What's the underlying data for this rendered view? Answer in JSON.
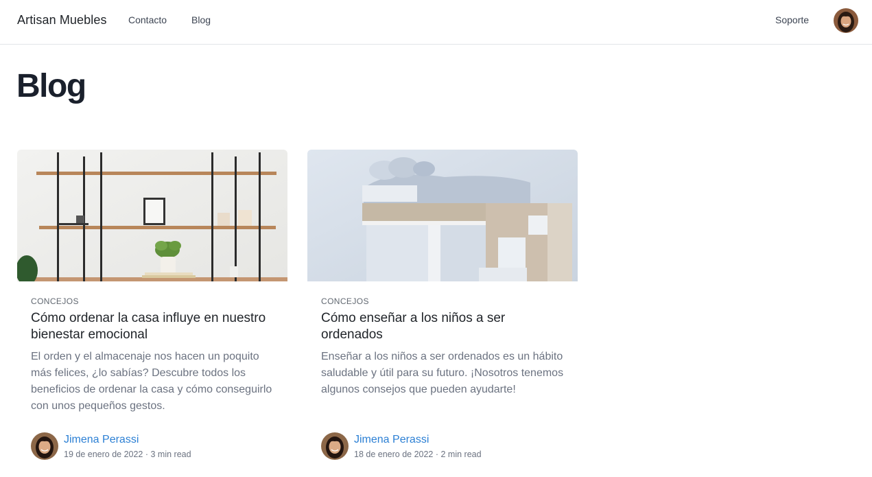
{
  "header": {
    "brand": "Artisan Muebles",
    "nav": [
      {
        "label": "Contacto"
      },
      {
        "label": "Blog"
      }
    ],
    "support_label": "Soporte"
  },
  "page": {
    "title": "Blog"
  },
  "posts": [
    {
      "category": "CONCEJOS",
      "title": "Cómo ordenar la casa influye en nuestro bienestar emocional",
      "excerpt": "El orden y el almacenaje nos hacen un poquito más felices, ¿lo sabías? Descubre todos los beneficios de ordenar la casa y cómo conseguirlo con unos pequeños gestos.",
      "author": "Jimena Perassi",
      "meta": "19 de enero de 2022 · 3 min read"
    },
    {
      "category": "CONCEJOS",
      "title": "Cómo enseñar a los niños a ser ordenados",
      "excerpt": "Enseñar a los niños a ser ordenados es un hábito saludable y útil para su futuro. ¡Nosotros tenemos algunos consejos que pueden ayudarte!",
      "author": "Jimena Perassi",
      "meta": "18 de enero de 2022 · 2 min read"
    }
  ],
  "colors": {
    "link": "#2b7fd4",
    "heading": "#1a202c",
    "muted": "#6b7280"
  }
}
